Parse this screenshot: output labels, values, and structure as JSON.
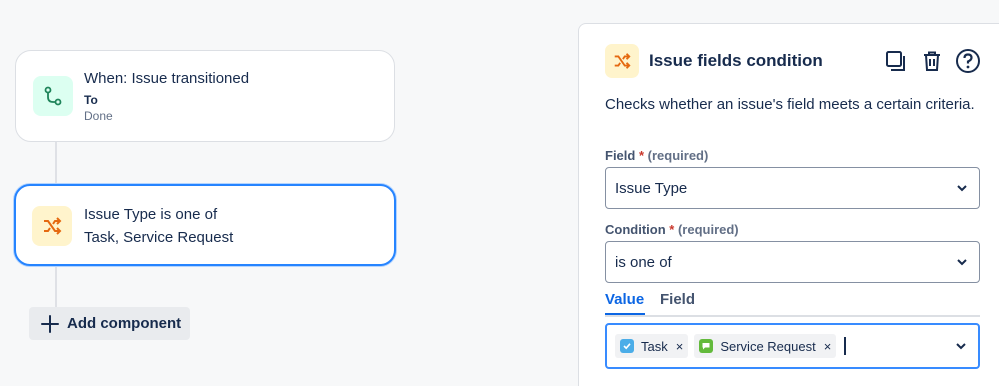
{
  "canvas": {
    "trigger": {
      "title": "When: Issue transitioned",
      "sub_label": "To",
      "sub_value": "Done",
      "icon": "branch-icon"
    },
    "condition": {
      "line1": "Issue Type is one of",
      "line2": "Task, Service Request",
      "icon": "shuffle-icon"
    },
    "add_component": {
      "label": "Add component",
      "icon": "plus-icon"
    }
  },
  "panel": {
    "title": "Issue fields condition",
    "icon": "shuffle-icon",
    "actions": [
      "copy-icon",
      "trash-icon",
      "help-icon"
    ],
    "description": "Checks whether an issue's field meets a certain criteria.",
    "field": {
      "label": "Field",
      "required_mark": "*",
      "hint": "(required)",
      "value": "Issue Type"
    },
    "condition": {
      "label": "Condition",
      "required_mark": "*",
      "hint": "(required)",
      "value": "is one of"
    },
    "tabs": [
      {
        "label": "Value",
        "active": true
      },
      {
        "label": "Field",
        "active": false
      }
    ],
    "values": [
      {
        "label": "Task",
        "icon": "task-check-icon",
        "remove": "×"
      },
      {
        "label": "Service Request",
        "icon": "service-request-icon",
        "remove": "×"
      }
    ]
  },
  "colors": {
    "accent": "#0c66e4",
    "selected_border": "#2684ff",
    "condition_icon_bg": "#fff4cc",
    "condition_icon_fg": "#e56910",
    "trigger_icon_bg": "#dcfff1",
    "trigger_icon_fg": "#1f845a",
    "required": "#c9372c"
  }
}
